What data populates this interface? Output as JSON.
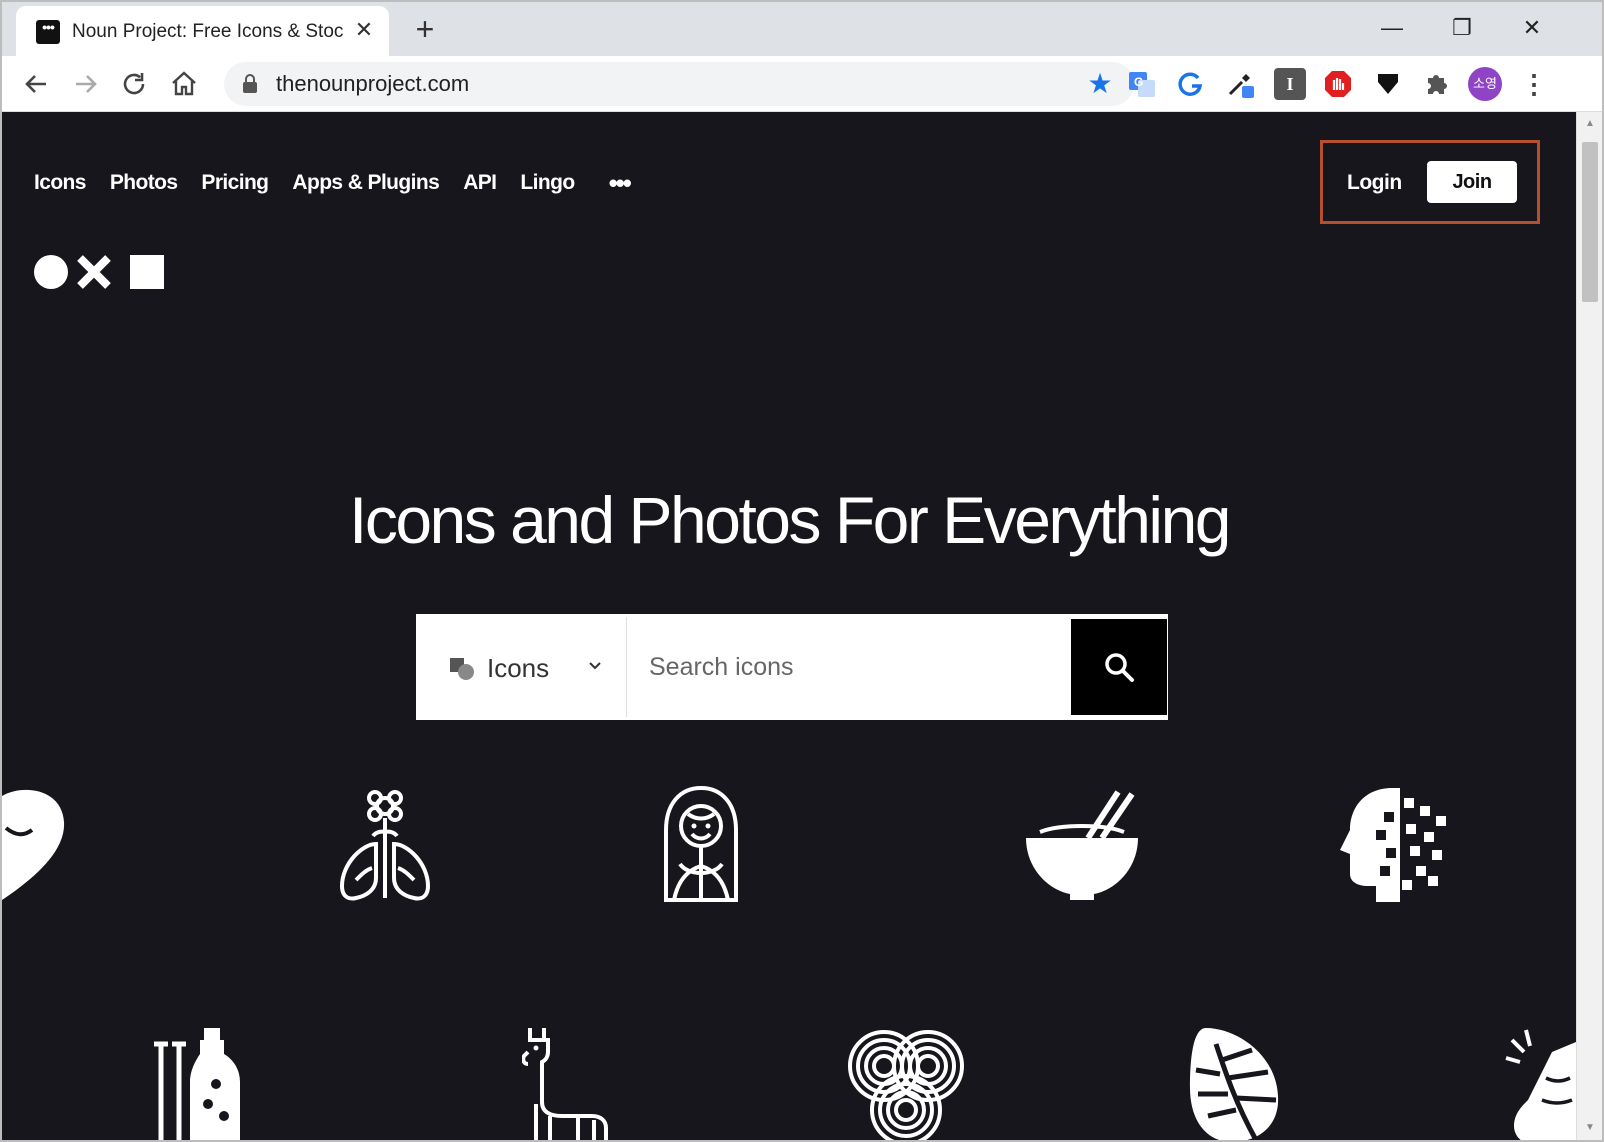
{
  "browser": {
    "tab_title": "Noun Project: Free Icons & Stock Photos",
    "tab_close": "✕",
    "new_tab": "+",
    "url": "thenounproject.com",
    "window_minimize": "—",
    "window_restore": "❐",
    "window_close": "✕",
    "profile_initials": "소영",
    "extensions": [
      "google-translate-icon",
      "grammarly-icon",
      "eyedropper-icon",
      "instapaper-icon",
      "adblock-icon",
      "pocket-download-icon",
      "extensions-puzzle-icon",
      "profile-avatar",
      "menu-kebab-icon"
    ]
  },
  "nav": {
    "items": [
      "Icons",
      "Photos",
      "Pricing",
      "Apps & Plugins",
      "API",
      "Lingo"
    ],
    "more": "•••",
    "login": "Login",
    "join": "Join"
  },
  "hero": {
    "title": "Icons and Photos For Everything"
  },
  "search": {
    "type_label": "Icons",
    "placeholder": "Search icons"
  },
  "icons": [
    "heart-icon",
    "lungs-flower-icon",
    "woman-portrait-icon",
    "bowl-chopsticks-icon",
    "head-pixels-icon",
    "test-tubes-bottle-icon",
    "llama-icon",
    "spiral-knot-icon",
    "monstera-leaf-icon",
    "hand-gesture-icon"
  ]
}
